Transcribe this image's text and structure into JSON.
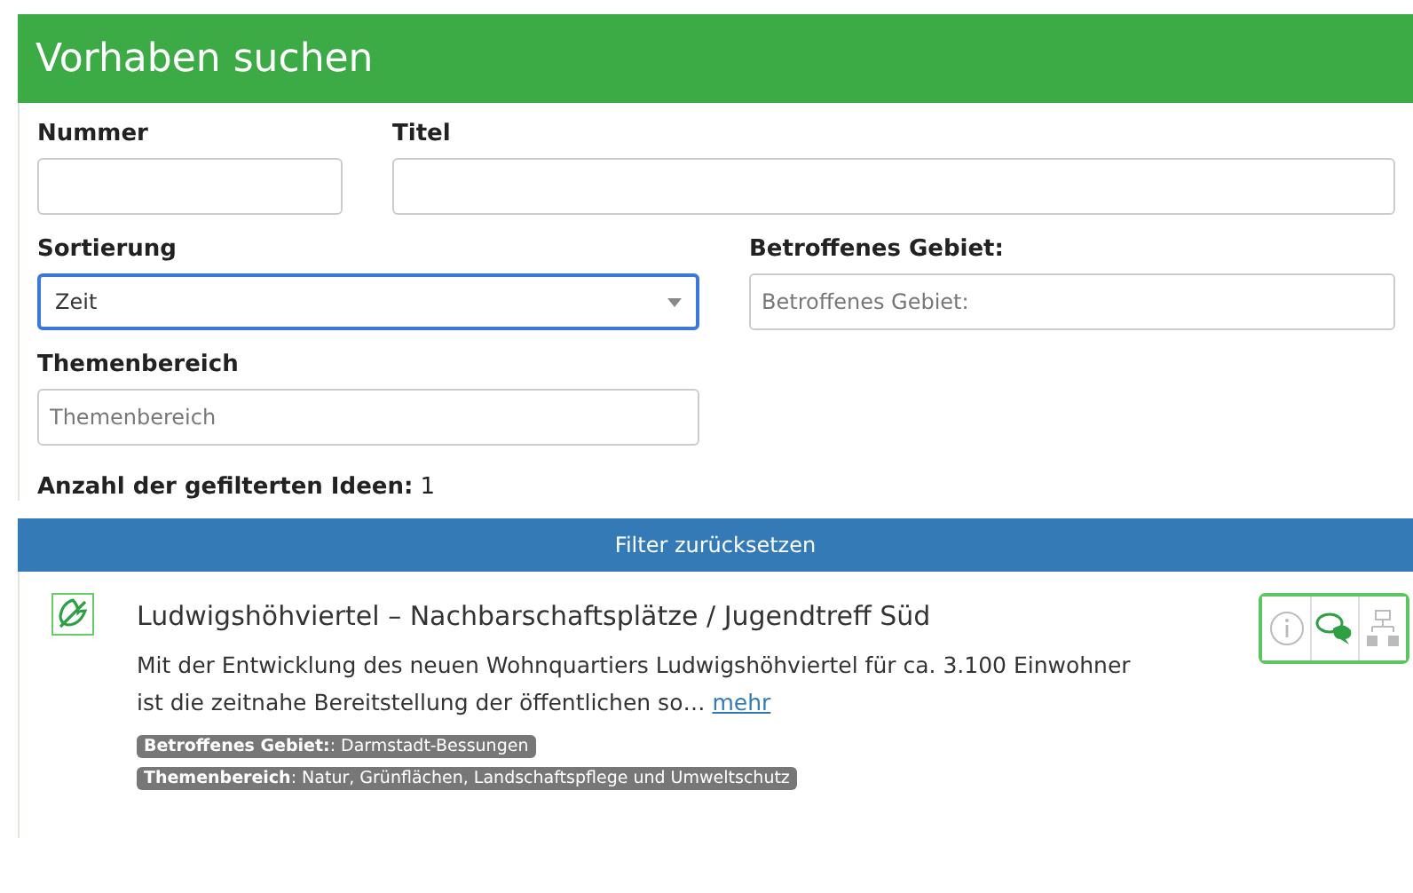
{
  "header": {
    "title": "Vorhaben suchen"
  },
  "fields": [
    {
      "kind": "text",
      "label": "Nummer"
    },
    {
      "kind": "text",
      "label": "Titel"
    },
    {
      "kind": "select",
      "label": "Sortierung",
      "value": "Zeit",
      "focused": true
    },
    {
      "kind": "text",
      "label": "Betroffenes Gebiet:",
      "placeholder": "Betroffenes Gebiet:"
    },
    {
      "kind": "text",
      "label": "Themenbereich",
      "placeholder": "Themenbereich"
    }
  ],
  "count": {
    "label": "Anzahl der gefilterten Ideen:",
    "value": "1"
  },
  "reset_button": "Filter zurücksetzen",
  "results": [
    {
      "title": "Ludwigshöhviertel – Nachbarschaftsplätze / Jugendtreff Süd",
      "description": "Mit der Entwicklung des neuen Wohnquartiers Ludwigshöhviertel für ca. 3.100 Einwohner ist die zeitnahe Bereitstellung der öffentlichen so…",
      "more": "mehr",
      "tags": [
        "**Betroffenes Gebiet:**: Darmstadt-Bessungen",
        "**Themenbereich**: Natur, Grünflächen, Landschaftspflege und Umweltschutz"
      ],
      "actions": [
        {
          "kind": "info",
          "active": false
        },
        {
          "kind": "comments",
          "active": true
        },
        {
          "kind": "structure",
          "active": false
        }
      ]
    }
  ]
}
